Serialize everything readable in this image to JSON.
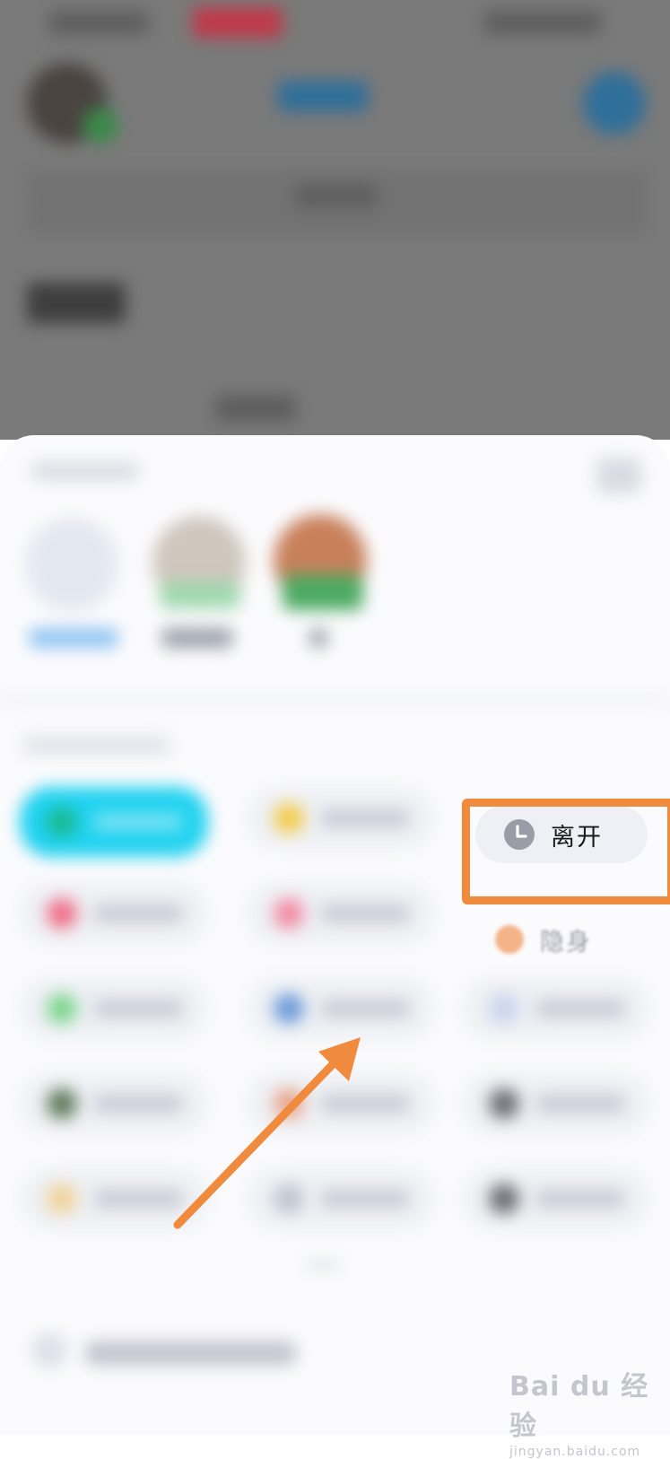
{
  "status_menu": {
    "leave_label": "离开",
    "invisible_label": "隐身"
  },
  "watermark": {
    "brand": "Bai du 经验",
    "site": "jingyan.baidu.com"
  },
  "colors": {
    "highlight": "#f08a3c",
    "online_pill": "#20d2f0",
    "sheet_background": "#fbfbfd"
  },
  "icons": {
    "leave": "clock-icon",
    "invisible": "moon-icon",
    "pointer": "arrow-icon"
  }
}
